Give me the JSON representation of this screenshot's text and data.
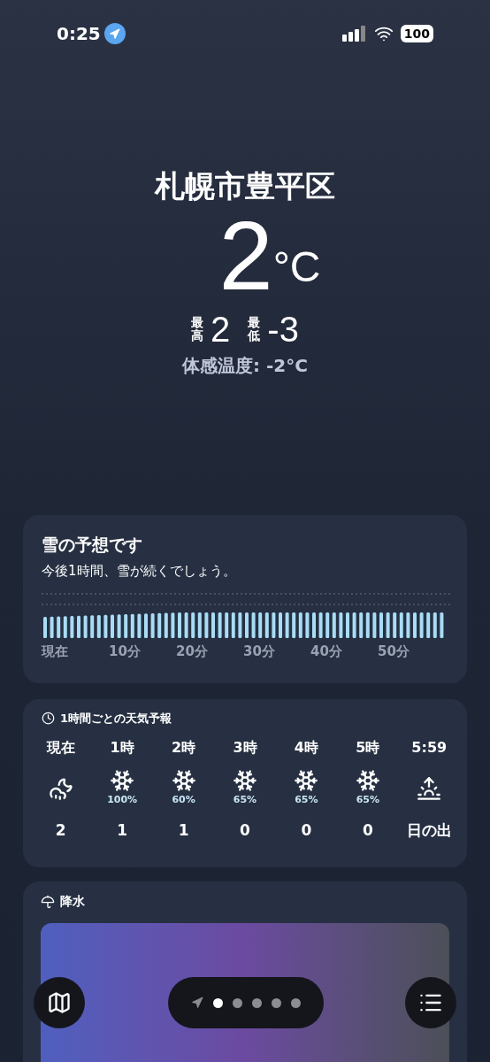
{
  "status_bar": {
    "time": "0:25",
    "battery": "100"
  },
  "location": {
    "city": "札幌市豊平区",
    "temperature": "2",
    "unit": "°C",
    "high_label": "最高",
    "high": "2",
    "low_label": "最低",
    "low": "-3",
    "feels_like": "体感温度: -2°C"
  },
  "minute_card": {
    "title": "雪の予想です",
    "subtitle": "今後1時間、雪が続くでしょう。",
    "axis_labels": [
      "現在",
      "10分",
      "20分",
      "30分",
      "40分",
      "50分"
    ]
  },
  "hourly_card": {
    "title": "1時間ごとの天気予報",
    "hours": [
      {
        "time": "現在",
        "kind": "cloud-moon-rain",
        "temp": "2"
      },
      {
        "time": "1時",
        "kind": "snow",
        "chance": "100%",
        "temp": "1"
      },
      {
        "time": "2時",
        "kind": "snow",
        "chance": "60%",
        "temp": "1"
      },
      {
        "time": "3時",
        "kind": "snow",
        "chance": "65%",
        "temp": "0"
      },
      {
        "time": "4時",
        "kind": "snow",
        "chance": "65%",
        "temp": "0"
      },
      {
        "time": "5時",
        "kind": "snow",
        "chance": "65%",
        "temp": "0"
      },
      {
        "time": "5:59",
        "kind": "sunrise",
        "temp": "日の出"
      }
    ]
  },
  "precip_card": {
    "title": "降水"
  },
  "page_indicator": [
    {
      "kind": "location",
      "selected": false
    },
    {
      "kind": "dot",
      "selected": true
    },
    {
      "kind": "dot",
      "selected": false
    },
    {
      "kind": "dot",
      "selected": false
    },
    {
      "kind": "dot",
      "selected": false
    },
    {
      "kind": "dot",
      "selected": false
    }
  ]
}
